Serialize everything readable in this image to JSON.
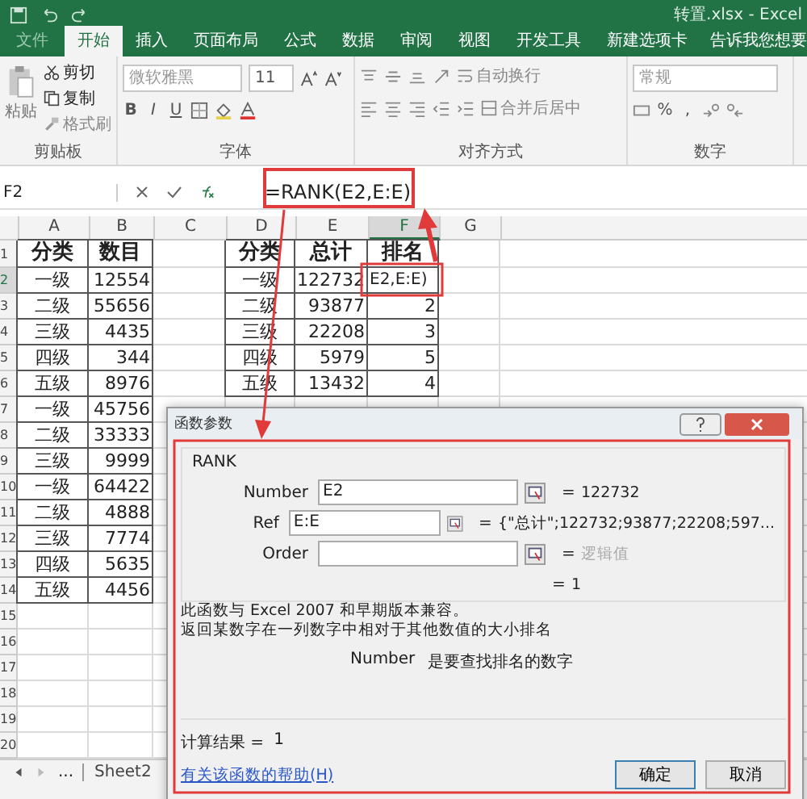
{
  "title_bar": {
    "title": "转置.xlsx - Excel"
  },
  "tabs": [
    {
      "label": "文件",
      "selected": false
    },
    {
      "label": "开始",
      "selected": true
    },
    {
      "label": "插入",
      "selected": false
    },
    {
      "label": "页面布局",
      "selected": false
    },
    {
      "label": "公式",
      "selected": false
    },
    {
      "label": "数据",
      "selected": false
    },
    {
      "label": "审阅",
      "selected": false
    },
    {
      "label": "视图",
      "selected": false
    },
    {
      "label": "开发工具",
      "selected": false
    },
    {
      "label": "新建选项卡",
      "selected": false
    }
  ],
  "tell_me": "告诉我您想要",
  "ribbon": {
    "clipboard": {
      "paste": "粘贴",
      "cut": "剪切",
      "copy": "复制",
      "format_painter": "格式刷",
      "label": "剪贴板"
    },
    "font": {
      "name": "微软雅黑",
      "size": "11",
      "bold": "B",
      "italic": "I",
      "underline": "U",
      "label": "字体"
    },
    "alignment": {
      "wrap": "自动换行",
      "merge": "合并后居中",
      "label": "对齐方式"
    },
    "number": {
      "format": "常规",
      "percent": "%",
      "comma": ",",
      "label": "数字"
    }
  },
  "formula_bar": {
    "name_box": "F2",
    "formula": "=RANK(E2,E:E)"
  },
  "columns": [
    {
      "label": "A",
      "selected": false
    },
    {
      "label": "B",
      "selected": false
    },
    {
      "label": "C",
      "selected": false
    },
    {
      "label": "D",
      "selected": false
    },
    {
      "label": "E",
      "selected": false
    },
    {
      "label": "F",
      "selected": true
    },
    {
      "label": "G",
      "selected": false
    }
  ],
  "rows": [
    {
      "number": "1",
      "selected": false,
      "cells": {
        "A": "分类",
        "B": "数目",
        "D": "分类",
        "E": "总计",
        "F": "排名"
      }
    },
    {
      "number": "2",
      "selected": true,
      "cells": {
        "A": "一级",
        "B": "12554",
        "D": "一级",
        "E": "122732",
        "F": "E2,E:E)"
      }
    },
    {
      "number": "3",
      "selected": false,
      "cells": {
        "A": "二级",
        "B": "55656",
        "D": "二级",
        "E": "93877",
        "F": "2"
      }
    },
    {
      "number": "4",
      "selected": false,
      "cells": {
        "A": "三级",
        "B": "4435",
        "D": "三级",
        "E": "22208",
        "F": "3"
      }
    },
    {
      "number": "5",
      "selected": false,
      "cells": {
        "A": "四级",
        "B": "344",
        "D": "四级",
        "E": "5979",
        "F": "5"
      }
    },
    {
      "number": "6",
      "selected": false,
      "cells": {
        "A": "五级",
        "B": "8976",
        "D": "五级",
        "E": "13432",
        "F": "4"
      }
    },
    {
      "number": "7",
      "selected": false,
      "cells": {
        "A": "一级",
        "B": "45756"
      }
    },
    {
      "number": "8",
      "selected": false,
      "cells": {
        "A": "二级",
        "B": "33333"
      }
    },
    {
      "number": "9",
      "selected": false,
      "cells": {
        "A": "三级",
        "B": "9999"
      }
    },
    {
      "number": "10",
      "selected": false,
      "cells": {
        "A": "一级",
        "B": "64422"
      }
    },
    {
      "number": "11",
      "selected": false,
      "cells": {
        "A": "二级",
        "B": "4888"
      }
    },
    {
      "number": "12",
      "selected": false,
      "cells": {
        "A": "三级",
        "B": "7774"
      }
    },
    {
      "number": "13",
      "selected": false,
      "cells": {
        "A": "四级",
        "B": "5635"
      }
    },
    {
      "number": "14",
      "selected": false,
      "cells": {
        "A": "五级",
        "B": "4456"
      }
    },
    {
      "number": "15",
      "selected": false,
      "cells": {}
    },
    {
      "number": "16",
      "selected": false,
      "cells": {}
    },
    {
      "number": "17",
      "selected": false,
      "cells": {}
    },
    {
      "number": "18",
      "selected": false,
      "cells": {}
    },
    {
      "number": "19",
      "selected": false,
      "cells": {}
    },
    {
      "number": "20",
      "selected": false,
      "cells": {}
    }
  ],
  "sheet_nav": {
    "more": "...",
    "tabs": [
      {
        "label": "Sheet2"
      }
    ]
  },
  "dialog": {
    "title": "函数参数",
    "function": "RANK",
    "equals": "=",
    "args": [
      {
        "label": "Number",
        "value": "E2",
        "result": "122732",
        "muted": false
      },
      {
        "label": "Ref",
        "value": "E:E",
        "result": "{\"总计\";122732;93877;22208;597...",
        "muted": false
      },
      {
        "label": "Order",
        "result": "逻辑值",
        "muted": true
      }
    ],
    "formula_result": "1",
    "description": [
      "此函数与 Excel 2007 和早期版本兼容。",
      "返回某数字在一列数字中相对于其他数值的大小排名"
    ],
    "arg_help_name": "Number",
    "arg_help": "是要查找排名的数字",
    "calc_label": "计算结果 =",
    "calc_result": "1",
    "help_link": "有关该函数的帮助(H)",
    "buttons": [
      "确定",
      "取消"
    ]
  }
}
